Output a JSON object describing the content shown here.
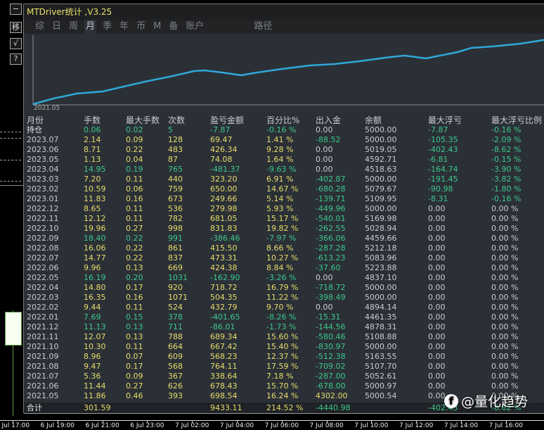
{
  "sidebar_buttons": [
    {
      "label": "−"
    },
    {
      "label": "移"
    },
    {
      "label": "√"
    },
    {
      "label": "?"
    }
  ],
  "window": {
    "title": "MTDriver统计 ,V3.25"
  },
  "tabs": [
    {
      "label": "综"
    },
    {
      "label": "日"
    },
    {
      "label": "周"
    },
    {
      "label": "月",
      "active": true
    },
    {
      "label": "季"
    },
    {
      "label": "年"
    },
    {
      "label": "币"
    },
    {
      "label": "M"
    },
    {
      "label": "备"
    },
    {
      "label": "账户"
    },
    {
      "label": "路径"
    }
  ],
  "equity_chart": {
    "start_label": "2021.05",
    "line_color": "#2fa8d8"
  },
  "table": {
    "headers": [
      "月份",
      "手数",
      "最大手数",
      "次数",
      "盈亏金额",
      "百分比%",
      "出入金",
      "余额",
      "最大浮亏",
      "最大浮亏比例"
    ],
    "rows": [
      [
        "持仓",
        "0.06",
        "0.02",
        "5",
        "-7.87",
        "-0.16 %",
        "0.00",
        "5000.00",
        "-7.87",
        "-0.16 %"
      ],
      [
        "2023.07",
        "2.14",
        "0.09",
        "128",
        "69.47",
        "1.41 %",
        "-88.52",
        "5000.00",
        "-105.35",
        "-2.09 %"
      ],
      [
        "2023.06",
        "8.71",
        "0.22",
        "483",
        "426.34",
        "9.28 %",
        "0.00",
        "5019.05",
        "-402.43",
        "-8.62 %"
      ],
      [
        "2023.05",
        "1.13",
        "0.04",
        "87",
        "74.08",
        "1.64 %",
        "0.00",
        "4592.71",
        "-6.81",
        "-0.15 %"
      ],
      [
        "2023.04",
        "14.95",
        "0.19",
        "765",
        "-481.37",
        "-9.63 %",
        "0.00",
        "4518.63",
        "-164.74",
        "-3.90 %"
      ],
      [
        "2023.03",
        "7.20",
        "0.11",
        "440",
        "323.20",
        "6.91 %",
        "-402.87",
        "5000.00",
        "-191.45",
        "-3.82 %"
      ],
      [
        "2023.02",
        "10.59",
        "0.06",
        "759",
        "650.00",
        "14.67 %",
        "-680.28",
        "5079.67",
        "-90.98",
        "-1.80 %"
      ],
      [
        "2023.01",
        "11.83",
        "0.16",
        "673",
        "249.66",
        "5.14 %",
        "-139.71",
        "5109.95",
        "-8.31",
        "-0.16 %"
      ],
      [
        "2022.12",
        "8.65",
        "0.11",
        "536",
        "279.98",
        "5.93 %",
        "-449.96",
        "5000.00",
        "0.00",
        "0.00 %"
      ],
      [
        "2022.11",
        "12.12",
        "0.11",
        "782",
        "681.05",
        "15.17 %",
        "-540.01",
        "5169.98",
        "0.00",
        "0.00 %"
      ],
      [
        "2022.10",
        "19.96",
        "0.27",
        "998",
        "831.83",
        "19.82 %",
        "-262.55",
        "5028.94",
        "0.00",
        "0.00 %"
      ],
      [
        "2022.09",
        "18.40",
        "0.22",
        "991",
        "-386.46",
        "-7.97 %",
        "-366.06",
        "4459.66",
        "0.00",
        "0.00 %"
      ],
      [
        "2022.08",
        "16.06",
        "0.22",
        "861",
        "415.50",
        "8.66 %",
        "-287.28",
        "5212.18",
        "0.00",
        "0.00 %"
      ],
      [
        "2022.07",
        "14.77",
        "0.22",
        "837",
        "473.31",
        "10.27 %",
        "-613.23",
        "5083.96",
        "0.00",
        "0.00 %"
      ],
      [
        "2022.06",
        "9.96",
        "0.13",
        "669",
        "424.38",
        "8.84 %",
        "-37.60",
        "5223.88",
        "0.00",
        "0.00 %"
      ],
      [
        "2022.05",
        "16.19",
        "0.20",
        "1031",
        "-162.90",
        "-3.26 %",
        "0.00",
        "4837.10",
        "0.00",
        "0.00 %"
      ],
      [
        "2022.04",
        "14.80",
        "0.17",
        "920",
        "718.72",
        "16.79 %",
        "-718.72",
        "5000.00",
        "0.00",
        "0.00 %"
      ],
      [
        "2022.03",
        "16.35",
        "0.16",
        "1071",
        "504.35",
        "11.22 %",
        "-398.49",
        "5000.00",
        "0.00",
        "0.00 %"
      ],
      [
        "2022.02",
        "9.44",
        "0.11",
        "524",
        "432.79",
        "9.70 %",
        "0.00",
        "4894.14",
        "0.00",
        "0.00 %"
      ],
      [
        "2022.01",
        "7.69",
        "0.15",
        "378",
        "-401.65",
        "-8.26 %",
        "-15.31",
        "4461.35",
        "0.00",
        "0.00 %"
      ],
      [
        "2021.12",
        "11.13",
        "0.13",
        "711",
        "-86.01",
        "-1.73 %",
        "-144.56",
        "4878.31",
        "0.00",
        "0.00 %"
      ],
      [
        "2021.11",
        "12.07",
        "0.13",
        "788",
        "689.34",
        "15.60 %",
        "-580.46",
        "5108.88",
        "0.00",
        "0.00 %"
      ],
      [
        "2021.10",
        "10.30",
        "0.11",
        "664",
        "667.42",
        "15.40 %",
        "-830.97",
        "5000.00",
        "0.00",
        "0.00 %"
      ],
      [
        "2021.09",
        "8.96",
        "0.07",
        "609",
        "568.23",
        "12.37 %",
        "-512.38",
        "5163.55",
        "0.00",
        "0.00 %"
      ],
      [
        "2021.08",
        "9.47",
        "0.17",
        "568",
        "764.11",
        "17.59 %",
        "-709.02",
        "5107.70",
        "0.00",
        "0.00 %"
      ],
      [
        "2021.07",
        "5.36",
        "0.09",
        "367",
        "338.64",
        "7.18 %",
        "-287.00",
        "5052.61",
        "0.00",
        "0.00 %"
      ],
      [
        "2021.06",
        "11.44",
        "0.27",
        "626",
        "678.43",
        "15.70 %",
        "-678.00",
        "5000.97",
        "0.00",
        "0.00 %"
      ],
      [
        "2021.05",
        "11.86",
        "0.46",
        "393",
        "698.54",
        "16.24 %",
        "4302.00",
        "5000.54",
        "0.00",
        "0.00 %"
      ]
    ],
    "total": [
      "合计",
      "301.59",
      "",
      "",
      "9433.11",
      "214.52 %",
      "-4440.98",
      "",
      "-402.43",
      "-8.62 %"
    ]
  },
  "time_axis": [
    "6 Jul 17:00",
    "6 Jul 19:00",
    "6 Jul 21:00",
    "6 Jul 23:00",
    "7 Jul 02:00",
    "7 Jul 04:00",
    "7 Jul 06:00",
    "7 Jul 08:00",
    "7 Jul 10:00",
    "7 Jul 12:00",
    "7 Jul 14:00",
    "7 Jul 16:00"
  ],
  "watermark": {
    "text": "@量化趋势",
    "logo": "f"
  },
  "colors": {
    "profit": "#e6dc6a",
    "loss": "#3cc88a",
    "neutral": "#c9ccd0"
  }
}
